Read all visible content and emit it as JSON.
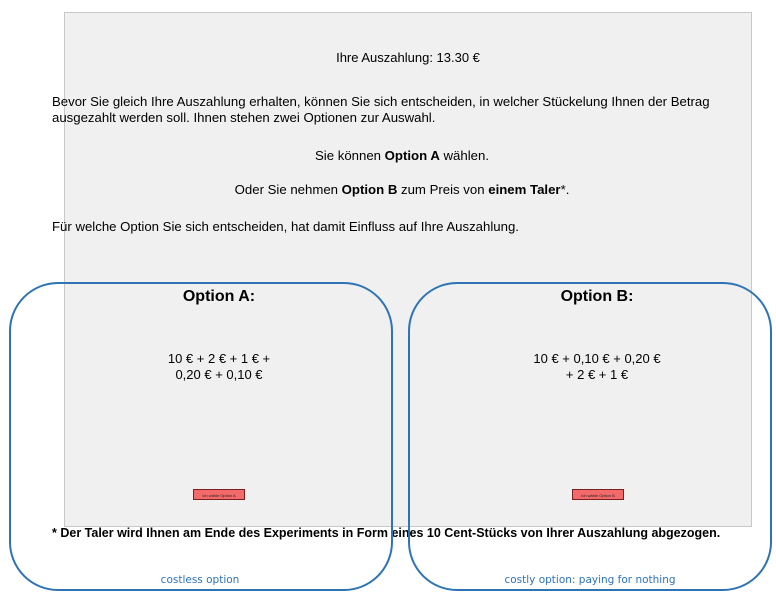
{
  "payout": {
    "label": "Ihre Auszahlung: 13.30 €"
  },
  "intro": "Bevor Sie gleich Ihre Auszahlung erhalten, können Sie sich entscheiden, in welcher Stückelung Ihnen der Betrag ausgezahlt werden soll. Ihnen stehen zwei Optionen zur Auswahl.",
  "line_a": {
    "pre": "Sie können ",
    "bold": "Option A",
    "post": " wählen."
  },
  "line_b": {
    "pre": "Oder Sie nehmen ",
    "bold1": "Option B",
    "mid": " zum Preis von ",
    "bold2": "einem Taler",
    "post": "*."
  },
  "influence": "Für welche Option Sie sich entscheiden, hat damit Einfluss auf Ihre Auszahlung.",
  "option_a": {
    "title": "Option A:",
    "line1": "10 € + 2 €  + 1 € +",
    "line2": "0,20 € + 0,10 €",
    "button": "Ich wähle Option A"
  },
  "option_b": {
    "title": "Option B:",
    "line1": "10 € + 0,10 € + 0,20 €",
    "line2": "+ 2 €  + 1 €",
    "button": "Ich wähle Option B"
  },
  "footnote": "* Der Taler wird Ihnen am Ende des Experiments in Form eines 10 Cent-Stücks von Ihrer Auszahlung abgezogen.",
  "annotations": {
    "left": "costless option",
    "right": "costly option: paying for nothing"
  },
  "colors": {
    "annotation_blue": "#2e74b5",
    "button_red": "#f36a6a",
    "panel_bg": "#f0f0f0"
  }
}
